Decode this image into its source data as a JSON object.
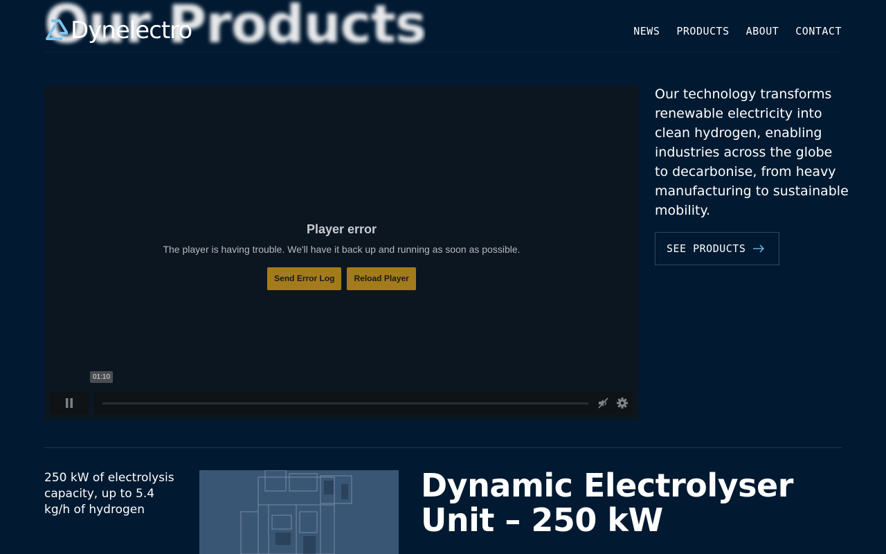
{
  "page": {
    "heading": "Our Products"
  },
  "brand": {
    "name": "Dynelectro",
    "logo_icon": "dynelectro-mark-icon"
  },
  "nav": {
    "items": [
      "NEWS",
      "PRODUCTS",
      "ABOUT",
      "CONTACT"
    ]
  },
  "player": {
    "error_title": "Player error",
    "error_message": "The player is having trouble. We'll have it back up and running as soon as possible.",
    "send_log_label": "Send Error Log",
    "reload_label": "Reload Player",
    "time_tooltip": "01:10",
    "icons": {
      "play_pause": "pause-icon",
      "mute": "muted-icon",
      "settings": "gear-icon"
    },
    "progress": 0
  },
  "intro": {
    "text": "Our technology transforms renewable electricity into clean hydrogen, enabling industries across the globe to decarbonise, from heavy manufacturing to sustainable mobility.",
    "cta_label": "SEE PRODUCTS",
    "cta_icon": "arrow-right-icon"
  },
  "product": {
    "capacity_text": "250 kW of electrolysis capacity, up to 5.4 kg/h of hydrogen",
    "title": "Dynamic Electrolyser Unit – 250 kW",
    "image_icon": "electrolyser-unit-image"
  },
  "colors": {
    "background": "#011a31",
    "button_accent": "#a47b1c",
    "outline": "#2b4a66"
  }
}
